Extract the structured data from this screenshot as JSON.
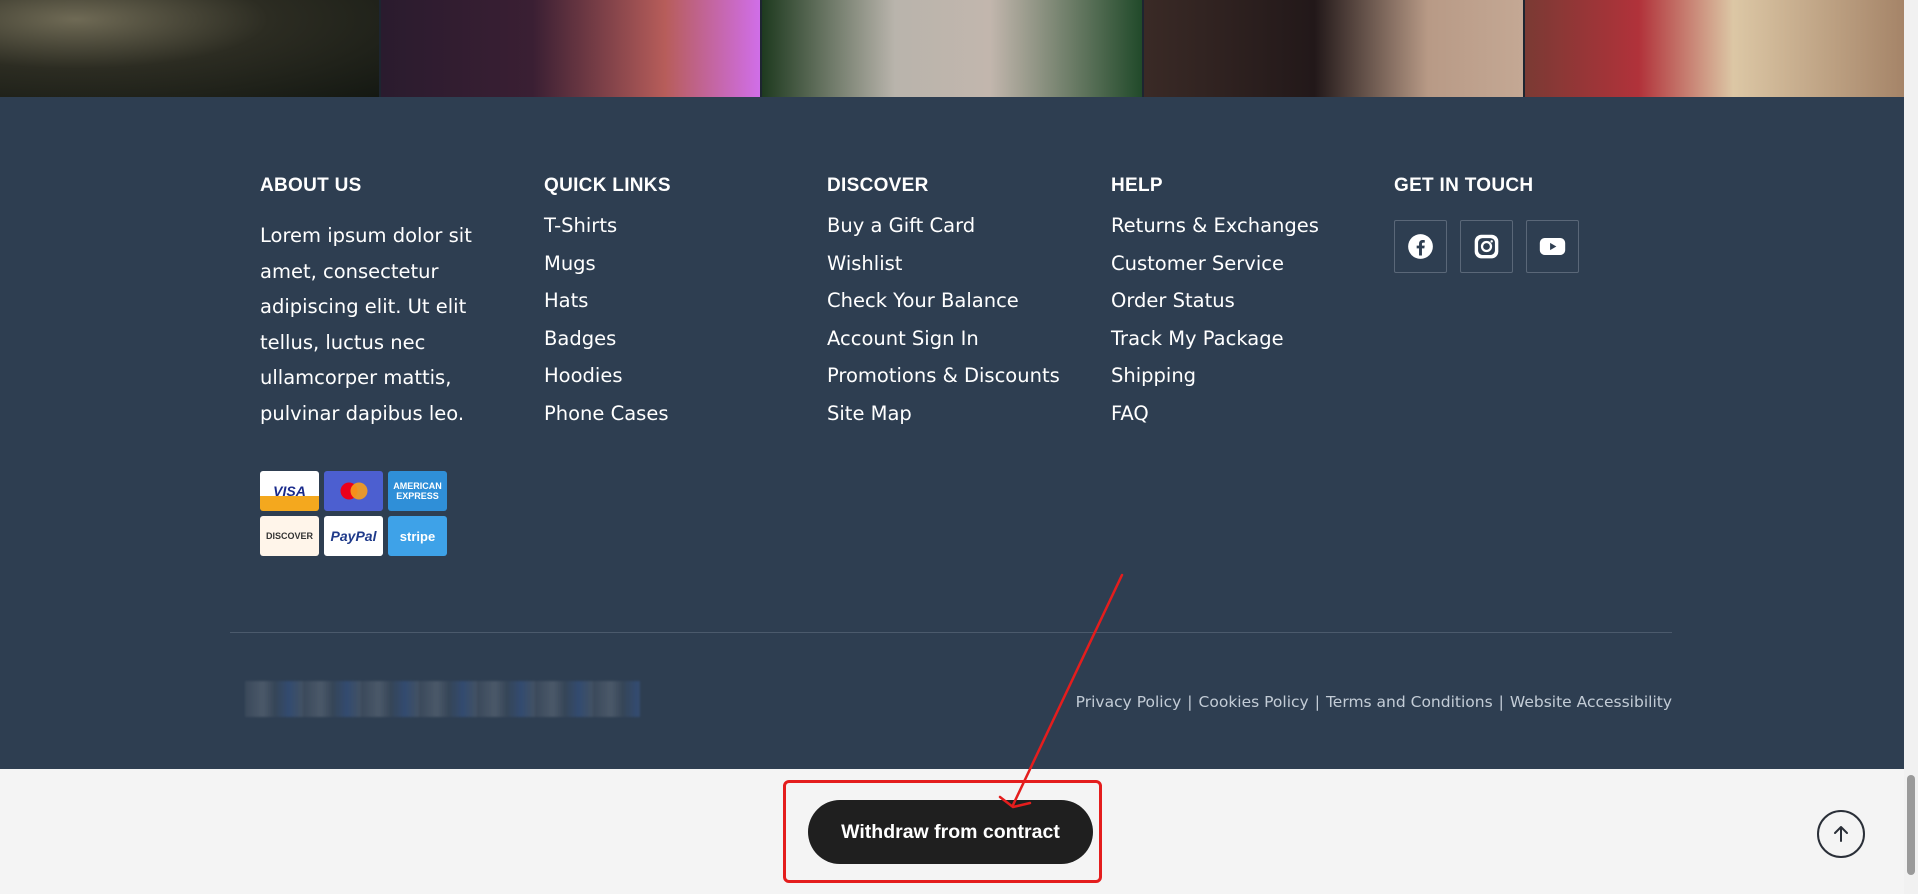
{
  "footer": {
    "about": {
      "heading": "ABOUT US",
      "text": "Lorem ipsum dolor sit amet, consectetur adipiscing elit. Ut elit tellus, luctus nec ullamcorper mattis, pulvinar dapibus leo."
    },
    "quick_links": {
      "heading": "QUICK LINKS",
      "items": [
        "T-Shirts",
        "Mugs",
        "Hats",
        "Badges",
        "Hoodies",
        "Phone Cases"
      ]
    },
    "discover": {
      "heading": "DISCOVER",
      "items": [
        "Buy a Gift Card",
        "Wishlist",
        "Check Your Balance",
        "Account Sign In",
        "Promotions & Discounts",
        "Site Map"
      ]
    },
    "help": {
      "heading": "HELP",
      "items": [
        "Returns & Exchanges",
        "Customer Service",
        "Order Status",
        "Track My Package",
        "Shipping",
        "FAQ"
      ]
    },
    "get_in_touch": {
      "heading": "GET IN TOUCH",
      "icons": [
        "facebook-icon",
        "instagram-icon",
        "youtube-icon"
      ]
    },
    "payments": {
      "visa": "VISA",
      "amex": "AMERICAN EXPRESS",
      "discover": "DISCOVER",
      "paypal": "PayPal",
      "stripe": "stripe"
    },
    "legal": {
      "privacy": "Privacy Policy",
      "cookies": "Cookies Policy",
      "terms": "Terms and Conditions",
      "accessibility": "Website Accessibility",
      "separator": "|"
    }
  },
  "withdraw_button": {
    "label": "Withdraw from contract"
  },
  "colors": {
    "footer_bg": "#2e3e51",
    "annotation": "#e41d1d",
    "button_bg": "#1f1f1f",
    "page_bg": "#f4f4f4"
  }
}
